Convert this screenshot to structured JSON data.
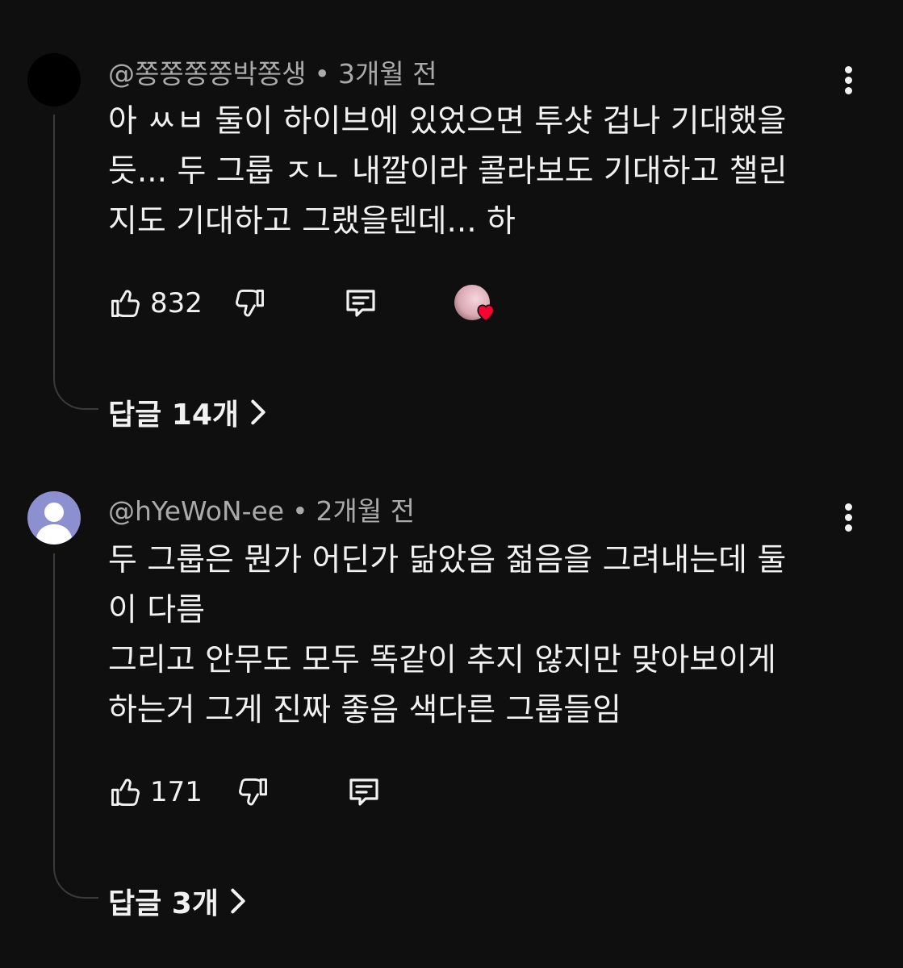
{
  "comments": [
    {
      "username": "@쫑쫑쫑쫑박쫑생",
      "separator": "•",
      "time": "3개월 전",
      "lines": [
        "아 ㅆㅂ 둘이 하이브에 있었으면 투샷 겁나 기대했을",
        "듯... 두 그룹 ㅈㄴ 내깔이라 콜라보도 기대하고 챌린",
        "지도 기대하고 그랬을텐데... 하"
      ],
      "likes": "832",
      "replies_label": "답글 14개",
      "creator_heart": true,
      "icons": {
        "avatar": "user-avatar-icon",
        "like": "thumbs-up-icon",
        "dislike": "thumbs-down-icon",
        "reply": "reply-icon",
        "menu": "more-vertical-icon",
        "heart": "creator-heart-icon",
        "chevron": "chevron-right-icon"
      }
    },
    {
      "username": "@hYeWoN-ee",
      "separator": "•",
      "time": "2개월 전",
      "lines": [
        "두 그룹은 뭔가 어딘가 닮았음 젊음을 그려내는데 둘",
        "이 다름",
        "그리고 안무도 모두 똑같이 추지 않지만 맞아보이게",
        "하는거 그게 진짜 좋음 색다른 그룹들임"
      ],
      "likes": "171",
      "replies_label": "답글 3개",
      "creator_heart": false,
      "icons": {
        "avatar": "default-avatar-icon",
        "like": "thumbs-up-icon",
        "dislike": "thumbs-down-icon",
        "reply": "reply-icon",
        "menu": "more-vertical-icon",
        "chevron": "chevron-right-icon"
      }
    }
  ],
  "colors": {
    "background": "#0f0f0f",
    "text": "#f1f1f1",
    "meta": "#aaaaaa",
    "default_avatar": "#8c8fd0",
    "heart": "#ff0033"
  }
}
